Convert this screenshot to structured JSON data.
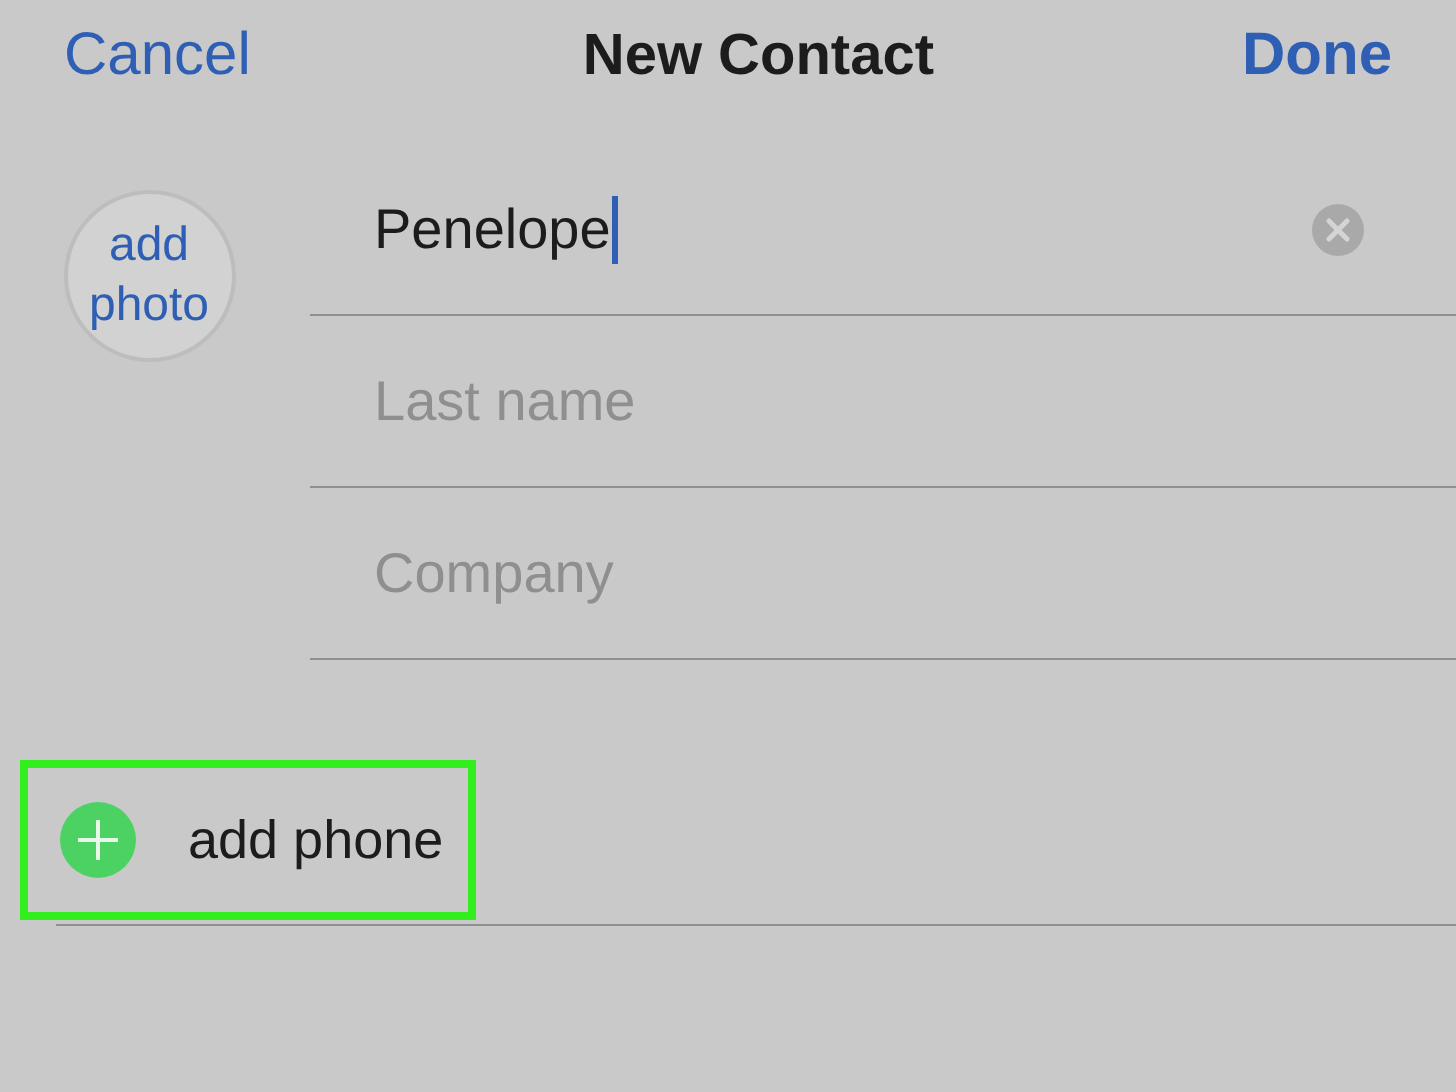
{
  "nav": {
    "cancel": "Cancel",
    "title": "New Contact",
    "done": "Done"
  },
  "photo": {
    "label": "add photo"
  },
  "fields": [
    {
      "value": "Penelope",
      "focused": true
    },
    {
      "placeholder": "Last name",
      "focused": false
    },
    {
      "placeholder": "Company",
      "focused": false
    }
  ],
  "add_phone": {
    "label": "add phone",
    "highlighted": true
  }
}
